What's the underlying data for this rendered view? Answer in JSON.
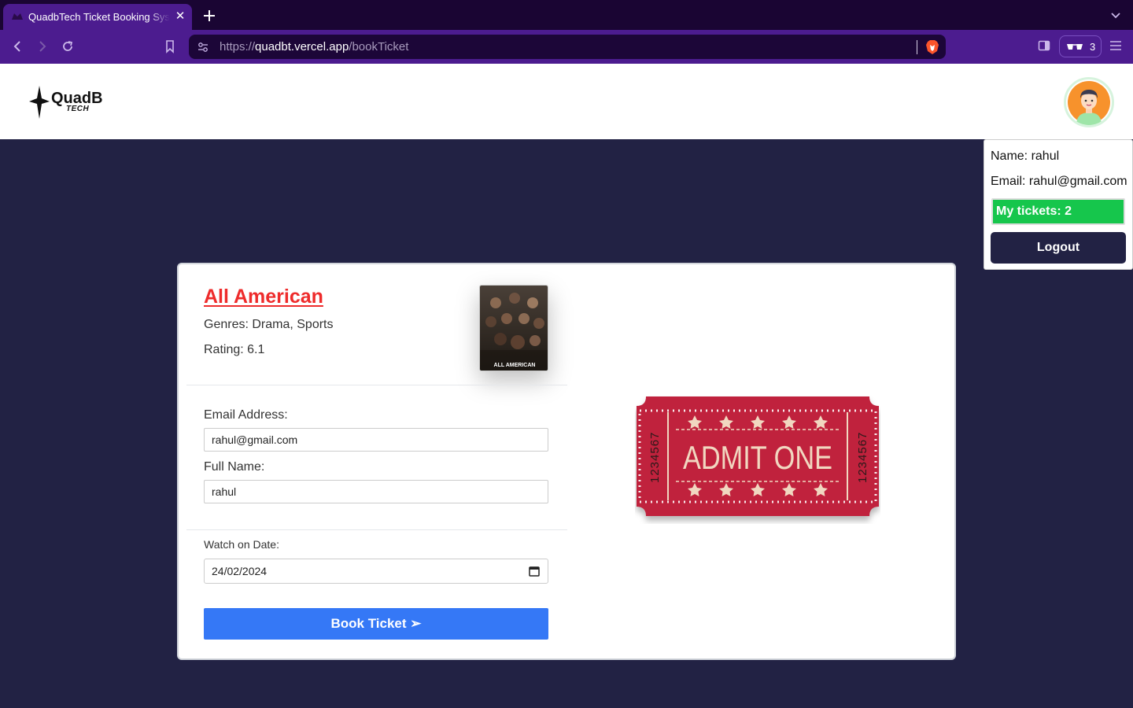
{
  "browser": {
    "tab_title": "QuadbTech Ticket Booking System",
    "tab_close": "✕",
    "url_scheme": "https://",
    "url_host": "quadbt.vercel.app",
    "url_path": "/bookTicket",
    "shields_count": "3"
  },
  "header": {
    "logo_text": "QuadB",
    "logo_sub": "TECH"
  },
  "user_menu": {
    "name": "Name: rahul",
    "email": "Email: rahul@gmail.com",
    "tickets": "My tickets: 2",
    "logout": "Logout"
  },
  "movie": {
    "title": "All American",
    "genres": "Genres: Drama, Sports",
    "rating": "Rating: 6.1",
    "poster_caption": "ALL AMERICAN"
  },
  "form": {
    "email_label": "Email Address:",
    "email_value": "rahul@gmail.com",
    "name_label": "Full Name:",
    "name_value": "rahul",
    "date_label": "Watch on Date:",
    "date_value": "24/02/2024",
    "submit": "Book Ticket ➢"
  },
  "ticket": {
    "text": "ADMIT ONE",
    "serial": "1234567"
  },
  "colors": {
    "page_bg": "#222244",
    "title_red": "#ee2b2b",
    "tickets_green": "#16c64c",
    "book_blue": "#3578f6",
    "browser_purple": "#4c1c8f"
  }
}
